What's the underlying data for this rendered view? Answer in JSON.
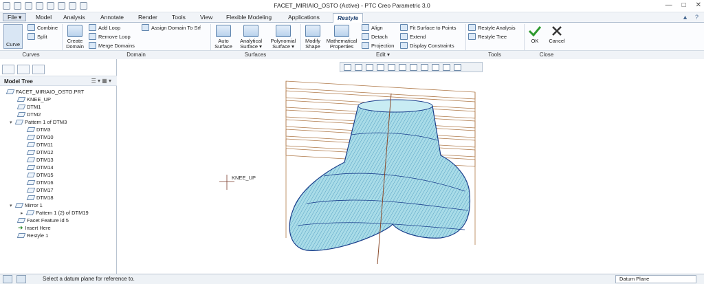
{
  "window": {
    "title": "FACET_MIRIAIO_OSTO (Active) - PTC Creo Parametric 3.0"
  },
  "menu_tabs": [
    {
      "label": "File ▾"
    },
    {
      "label": "Model"
    },
    {
      "label": "Analysis"
    },
    {
      "label": "Annotate"
    },
    {
      "label": "Render"
    },
    {
      "label": "Tools"
    },
    {
      "label": "View"
    },
    {
      "label": "Flexible Modeling"
    },
    {
      "label": "Applications"
    },
    {
      "label": "Restyle"
    }
  ],
  "ribbon": {
    "curve": "Curve",
    "combine": "Combine",
    "split": "Split",
    "create_domain_1": "Create",
    "create_domain_2": "Domain",
    "add_loop": "Add Loop",
    "remove_loop": "Remove Loop",
    "merge_domains": "Merge Domains",
    "assign_domain": "Assign Domain To Srf",
    "auto_surface_1": "Auto",
    "auto_surface_2": "Surface",
    "analytical_surface_1": "Analytical",
    "analytical_surface_2": "Surface ▾",
    "polynomial_surface_1": "Polynomial",
    "polynomial_surface_2": "Surface ▾",
    "modify_shape_1": "Modify",
    "modify_shape_2": "Shape",
    "math_props_1": "Mathematical",
    "math_props_2": "Properties",
    "align": "Align",
    "detach": "Detach",
    "projection": "Projection",
    "fit_surface": "Fit Surface to Points",
    "extend": "Extend",
    "display_constraints": "Display Constraints",
    "restyle_analysis": "Restyle Analysis",
    "restyle_tree": "Restyle Tree",
    "ok": "OK",
    "cancel": "Cancel"
  },
  "groups": {
    "curves": "Curves",
    "domain": "Domain",
    "surfaces": "Surfaces",
    "edit": "Edit ▾",
    "tools": "Tools",
    "close": "Close"
  },
  "model_tree": {
    "header": "Model Tree",
    "items": [
      {
        "label": "FACET_MIRIAIO_OSTO.PRT"
      },
      {
        "label": "KNEE_UP"
      },
      {
        "label": "DTM1"
      },
      {
        "label": "DTM2"
      },
      {
        "label": "Pattern 1 of DTM3"
      },
      {
        "label": "DTM3"
      },
      {
        "label": "DTM10"
      },
      {
        "label": "DTM11"
      },
      {
        "label": "DTM12"
      },
      {
        "label": "DTM13"
      },
      {
        "label": "DTM14"
      },
      {
        "label": "DTM15"
      },
      {
        "label": "DTM16"
      },
      {
        "label": "DTM17"
      },
      {
        "label": "DTM18"
      },
      {
        "label": "Mirror 1"
      },
      {
        "label": "Pattern 1 (2) of DTM19"
      },
      {
        "label": "Facet Feature id 5"
      },
      {
        "label": "Insert Here"
      },
      {
        "label": "Restyle 1"
      }
    ]
  },
  "viewport": {
    "csys_label": "KNEE_UP"
  },
  "status": {
    "message": "Select a datum plane for reference to.",
    "filter": "Datum Plane"
  }
}
